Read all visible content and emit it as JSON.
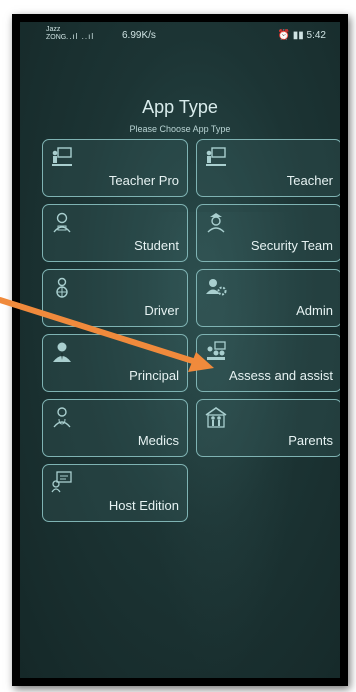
{
  "status_bar": {
    "carrier_top": "Jazz",
    "carrier_bottom": "ZONG",
    "signal": "..ıl ..ıl",
    "network_speed": "6.99K/s",
    "time": "5:42"
  },
  "header": {
    "title": "App Type",
    "subtitle": "Please Choose App Type"
  },
  "tiles": [
    {
      "label": "Teacher Pro",
      "icon": "teacher-board-icon"
    },
    {
      "label": "Teacher",
      "icon": "teacher-board-icon"
    },
    {
      "label": "Student",
      "icon": "student-icon"
    },
    {
      "label": "Security Team",
      "icon": "security-guard-icon"
    },
    {
      "label": "Driver",
      "icon": "driver-icon"
    },
    {
      "label": "Admin",
      "icon": "admin-gears-icon"
    },
    {
      "label": "Principal",
      "icon": "principal-icon"
    },
    {
      "label": "Assess and assist",
      "icon": "assess-group-icon"
    },
    {
      "label": "Medics",
      "icon": "doctor-icon"
    },
    {
      "label": "Parents",
      "icon": "family-home-icon"
    },
    {
      "label": "Host Edition",
      "icon": "host-edition-icon"
    }
  ],
  "colors": {
    "background": "#1c3434",
    "tile_border": "#7fb3b3",
    "arrow": "#f08a3c"
  }
}
